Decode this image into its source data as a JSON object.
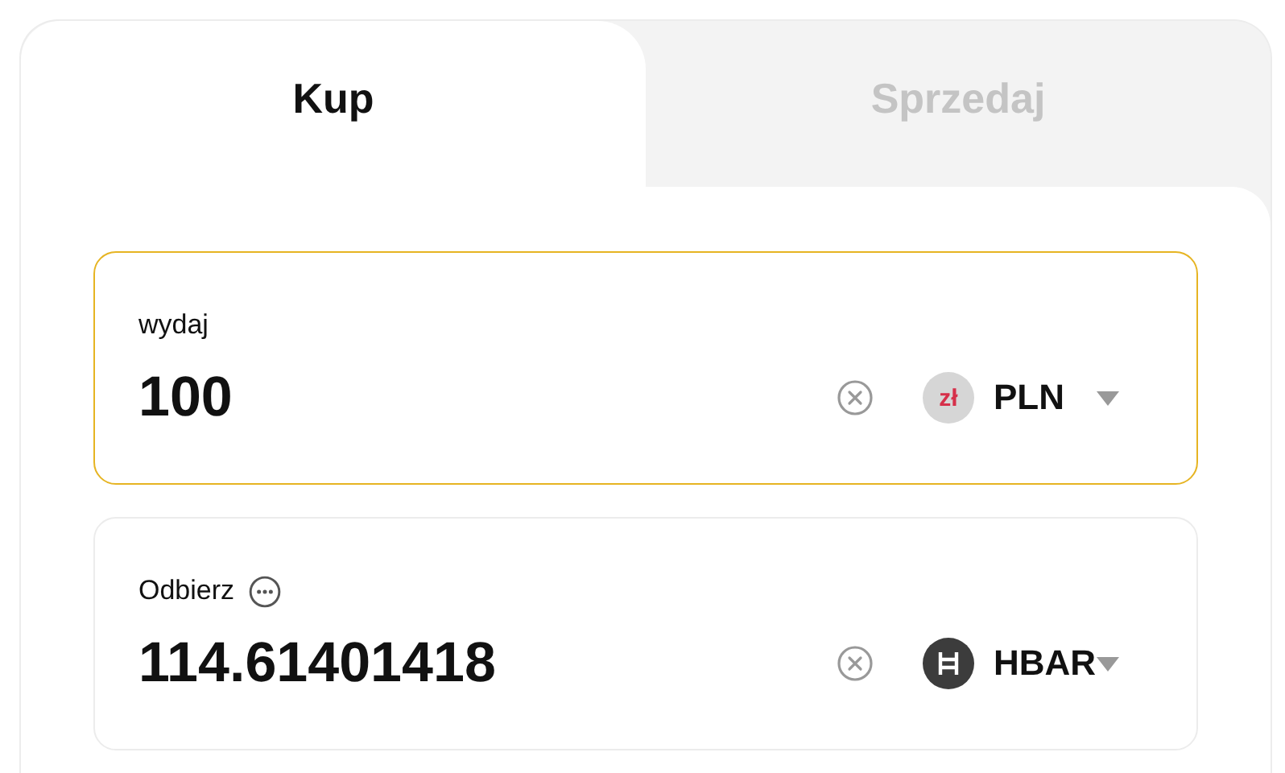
{
  "tabs": [
    {
      "label": "Kup",
      "selected": true
    },
    {
      "label": "Sprzedaj",
      "selected": false
    }
  ],
  "fields": [
    {
      "label": "wydaj",
      "has_info": false,
      "focused": true,
      "value": "100",
      "currency": {
        "kind": "symbol",
        "symbol": "zł",
        "code": "PLN"
      }
    },
    {
      "label": "Odbierz",
      "has_info": true,
      "focused": false,
      "value": "114.61401418",
      "currency": {
        "kind": "hbar",
        "code": "HBAR"
      }
    }
  ]
}
